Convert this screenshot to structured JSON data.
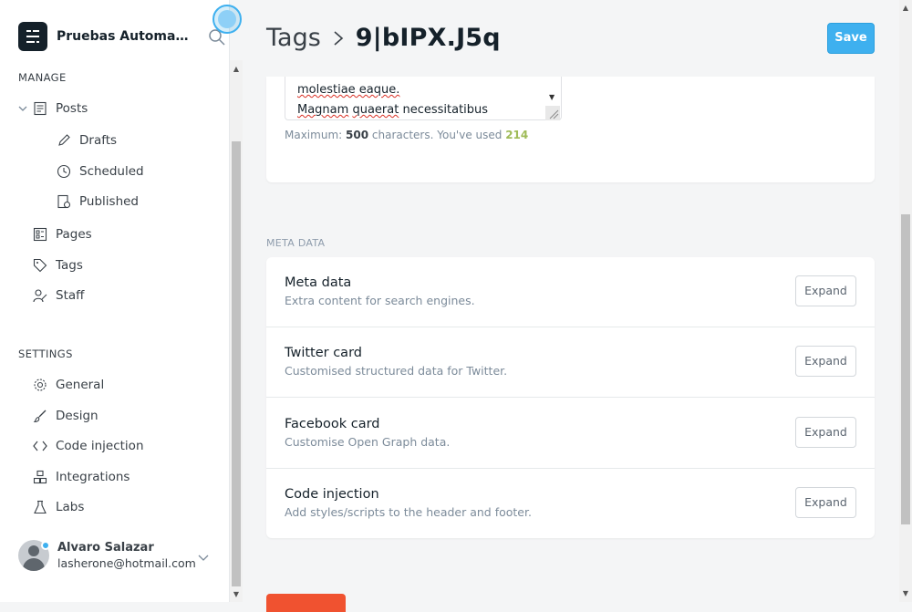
{
  "sidebar": {
    "site_name": "Pruebas Automatización",
    "manage_label": "MANAGE",
    "settings_label": "SETTINGS",
    "posts": "Posts",
    "drafts": "Drafts",
    "scheduled": "Scheduled",
    "published": "Published",
    "pages": "Pages",
    "tags": "Tags",
    "staff": "Staff",
    "general": "General",
    "design": "Design",
    "code_injection": "Code injection",
    "integrations": "Integrations",
    "labs": "Labs",
    "user_name": "Alvaro Salazar",
    "user_email": "lasherone@hotmail.com"
  },
  "header": {
    "breadcrumb_parent": "Tags",
    "breadcrumb_current": "9|bIPX.J5q",
    "save_label": "Save"
  },
  "description": {
    "line1": "molestiae eaque.",
    "line2_a": "Magnam",
    "line2_b": "quaerat",
    "line2_c": "necessitatibus",
    "max_prefix": "Maximum:",
    "max_value": "500",
    "used_prefix": "characters. You've used",
    "used_value": "214"
  },
  "meta": {
    "section_label": "META DATA",
    "rows": [
      {
        "title": "Meta data",
        "desc": "Extra content for search engines.",
        "button": "Expand"
      },
      {
        "title": "Twitter card",
        "desc": "Customised structured data for Twitter.",
        "button": "Expand"
      },
      {
        "title": "Facebook card",
        "desc": "Customise Open Graph data.",
        "button": "Expand"
      },
      {
        "title": "Code injection",
        "desc": "Add styles/scripts to the header and footer.",
        "button": "Expand"
      }
    ]
  },
  "colors": {
    "accent": "#3eb0ef",
    "danger": "#f05230",
    "used_count": "#9fbb58"
  }
}
